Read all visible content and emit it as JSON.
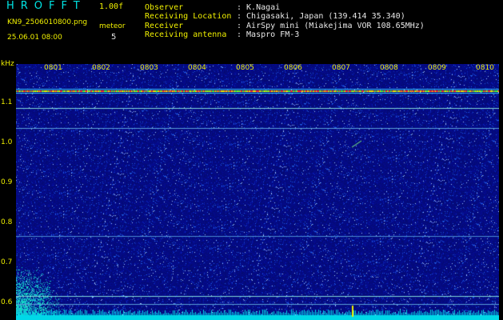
{
  "header": {
    "title": "HROFFT",
    "version": "1.00f",
    "filename": "KN9_2506010800.png",
    "meteor_label": "meteor",
    "meteor_count": "5",
    "datetime": "25.06.01 08:00"
  },
  "info": [
    {
      "label": "Observer",
      "value": ": K.Nagai"
    },
    {
      "label": "Receiving Location",
      "value": ": Chigasaki, Japan (139.414 35.340)"
    },
    {
      "label": "Receiver",
      "value": ": AirSpy mini (Miakejima VOR 108.65MHz)"
    },
    {
      "label": "Receiving antenna",
      "value": ": Maspro FM-3"
    }
  ],
  "axis": {
    "y_unit": "kHz",
    "y_ticks": [
      "1.1",
      "1.0",
      "0.9",
      "0.8",
      "0.7",
      "0.6"
    ],
    "x_ticks": [
      "0801",
      "0802",
      "0803",
      "0804",
      "0805",
      "0806",
      "0807",
      "0808",
      "0809",
      "0810"
    ]
  },
  "colors": {
    "label": "#00e5e5",
    "value": "#e8e8e8",
    "accent": "#f0f000",
    "background": "#000000",
    "noise_base": "#06107a"
  }
}
